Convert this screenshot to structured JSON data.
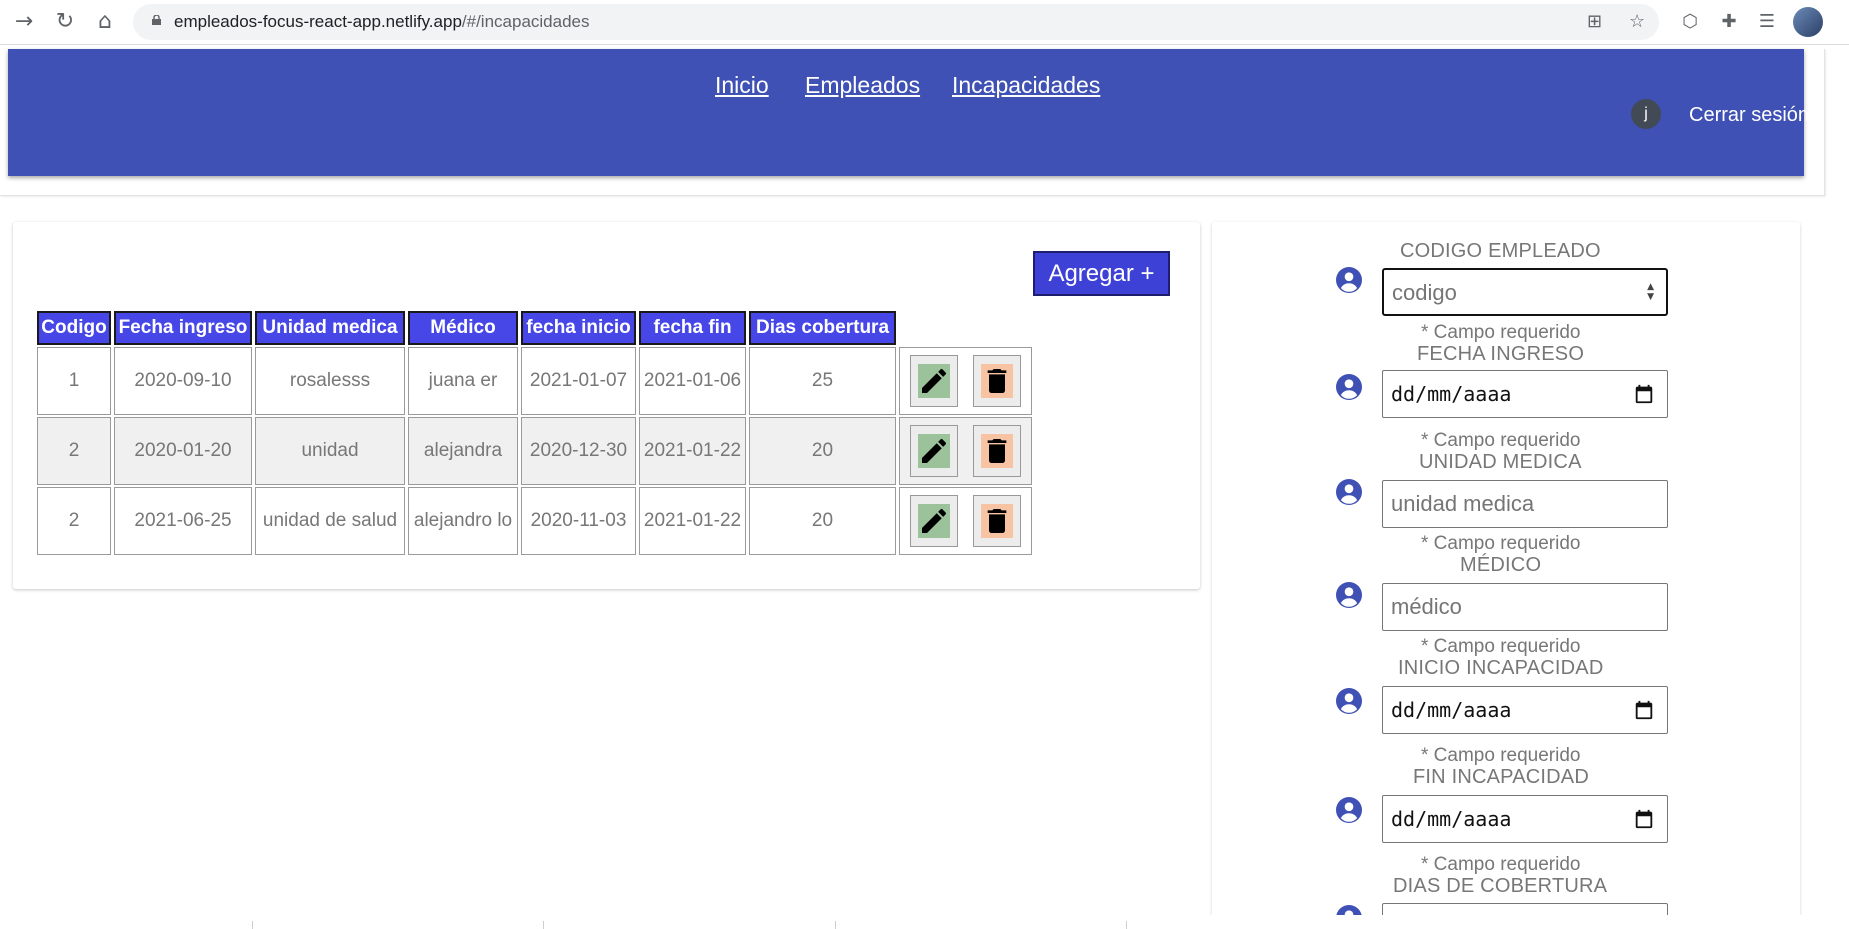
{
  "browser": {
    "url_host": "empleados-focus-react-app.netlify.app",
    "url_path": "/#/incapacidades",
    "icons": [
      "back-arrow-icon",
      "reload-icon",
      "home-icon",
      "lock-icon",
      "translate-icon",
      "star-icon",
      "extension-cube-icon",
      "puzzle-icon",
      "media-list-icon",
      "profile-avatar-icon"
    ]
  },
  "header": {
    "nav": [
      "Inicio",
      "Empleados",
      "Incapacidades"
    ],
    "avatar_letter": "j",
    "logout": "Cerrar sesión",
    "color": "#3f51b5"
  },
  "table": {
    "add_button": "Agregar +",
    "columns": [
      "Codigo",
      "Fecha ingreso",
      "Unidad medica",
      "Médico",
      "fecha inicio",
      "fecha fin",
      "Dias cobertura"
    ],
    "rows": [
      [
        "1",
        "2020-09-10",
        "rosalesss",
        "juana er",
        "2021-01-07",
        "2021-01-06",
        "25"
      ],
      [
        "2",
        "2020-01-20",
        "unidad",
        "alejandra",
        "2020-12-30",
        "2021-01-22",
        "20"
      ],
      [
        "2",
        "2021-06-25",
        "unidad de salud",
        "alejandro lo",
        "2020-11-03",
        "2021-01-22",
        "20"
      ]
    ],
    "header_color": "#4747e8",
    "edit_color": "#9bc29b",
    "delete_color": "#f7c3a2"
  },
  "form": {
    "required_text": "* Campo requerido",
    "fields": [
      {
        "label": "CODIGO EMPLEADO",
        "placeholder": "codigo"
      },
      {
        "label": "FECHA INGRESO",
        "placeholder": "dd/mm/aaaa"
      },
      {
        "label": "UNIDAD MEDICA",
        "placeholder": "unidad medica"
      },
      {
        "label": "MÉDICO",
        "placeholder": "médico"
      },
      {
        "label": "INICIO INCAPACIDAD",
        "placeholder": "dd/mm/aaaa"
      },
      {
        "label": "FIN INCAPACIDAD",
        "placeholder": "dd/mm/aaaa"
      },
      {
        "label": "DIAS DE COBERTURA",
        "placeholder": ""
      }
    ]
  }
}
